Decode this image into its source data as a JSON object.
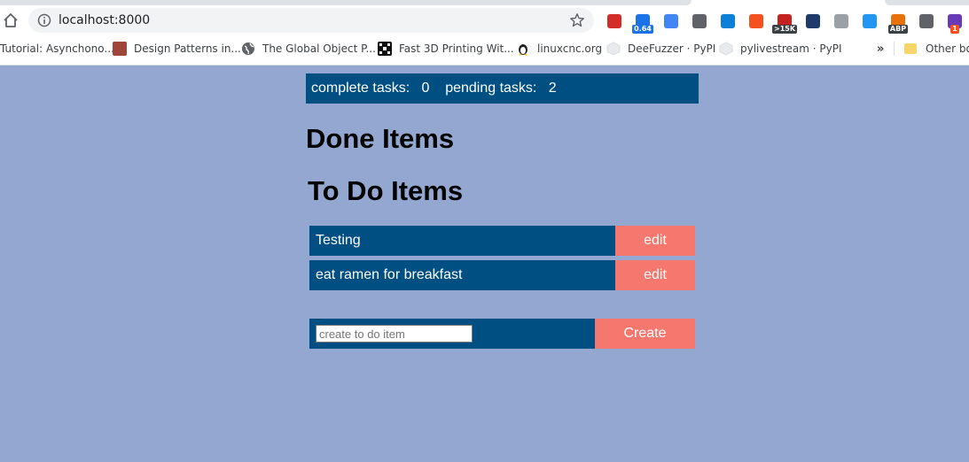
{
  "browser": {
    "url": "localhost:8000",
    "bookmarks": [
      {
        "label": "Tutorial: Asynchono...",
        "icon": "none"
      },
      {
        "label": "Design Patterns in...",
        "icon": "book-icon"
      },
      {
        "label": "The Global Object P...",
        "icon": "globe-icon"
      },
      {
        "label": "Fast 3D Printing Wit...",
        "icon": "pixel-icon"
      },
      {
        "label": "linuxcnc.org",
        "icon": "penguin-icon"
      },
      {
        "label": "DeeFuzzer · PyPI",
        "icon": "package-icon"
      },
      {
        "label": "pylivestream · PyPI",
        "icon": "package-icon"
      },
      {
        "label": "Other bo",
        "icon": "folder-icon"
      }
    ],
    "overflow_label": "»",
    "extensions": [
      {
        "name": "lastpass-icon",
        "color": "#d32d27",
        "badge": ""
      },
      {
        "name": "speed-icon",
        "color": "#1a73e8",
        "badge": "0.64"
      },
      {
        "name": "docs-icon",
        "color": "#4285f4",
        "badge": ""
      },
      {
        "name": "camera-icon",
        "color": "#5f6368",
        "badge": ""
      },
      {
        "name": "edge-icon",
        "color": "#0c7fd6",
        "badge": ""
      },
      {
        "name": "lighthouse-icon",
        "color": "#f4511e",
        "badge": ""
      },
      {
        "name": "gmail-icon",
        "color": "#c5221f",
        "badge": ">15K"
      },
      {
        "name": "j-icon",
        "color": "#1d3a6b",
        "badge": ""
      },
      {
        "name": "code-icon",
        "color": "#9aa0a6",
        "badge": ""
      },
      {
        "name": "puzzle-icon",
        "color": "#2196f3",
        "badge": ""
      },
      {
        "name": "abc-icon",
        "color": "#e8710a",
        "badge": "ABP"
      },
      {
        "name": "tetris-icon",
        "color": "#5f6368",
        "badge": ""
      },
      {
        "name": "star-burst-icon",
        "color": "#673ab7",
        "badge": "1"
      }
    ]
  },
  "app": {
    "complete_label": "complete tasks:",
    "complete_count": "0",
    "pending_label": "pending tasks:",
    "pending_count": "2",
    "done_heading": "Done Items",
    "todo_heading": "To Do Items",
    "todos": [
      {
        "text": "Testing",
        "edit_label": "edit"
      },
      {
        "text": "eat ramen for breakfast",
        "edit_label": "edit"
      }
    ],
    "create_placeholder": "create to do item",
    "create_value": "",
    "create_label": "Create"
  },
  "colors": {
    "page_bg": "#93a7d1",
    "bar_bg": "#004f83",
    "button_bg": "#f6776d"
  }
}
